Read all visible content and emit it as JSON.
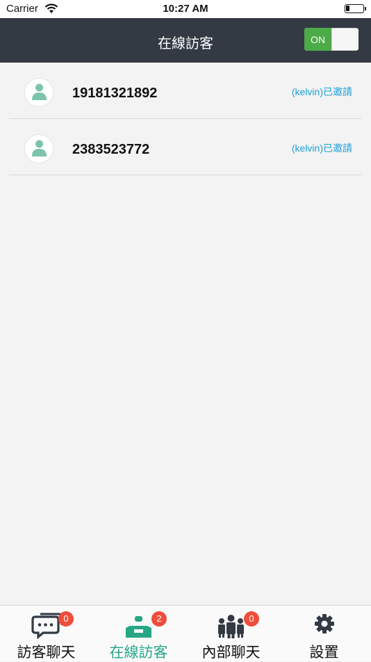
{
  "status_bar": {
    "carrier": "Carrier",
    "time": "10:27 AM"
  },
  "navbar": {
    "title": "在線訪客",
    "toggle_label": "ON"
  },
  "visitors": [
    {
      "id": "19181321892",
      "status": "(kelvin)已邀請"
    },
    {
      "id": "2383523772",
      "status": "(kelvin)已邀請"
    }
  ],
  "tabs": [
    {
      "label": "訪客聊天",
      "badge": "0",
      "icon": "chat-bubbles-icon"
    },
    {
      "label": "在線訪客",
      "badge": "2",
      "icon": "online-visitor-icon",
      "active": true
    },
    {
      "label": "內部聊天",
      "badge": "0",
      "icon": "group-people-icon"
    },
    {
      "label": "設置",
      "icon": "gear-icon"
    }
  ],
  "colors": {
    "navbar": "#333a44",
    "accent": "#27a686",
    "toggle_on": "#4caa48",
    "badge": "#ef4d3c",
    "link": "#1aa0d8"
  }
}
